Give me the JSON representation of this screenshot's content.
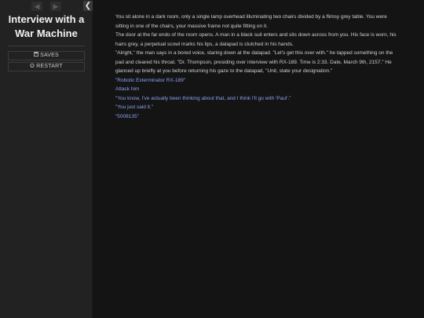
{
  "sidebar": {
    "back_arrow": "◀",
    "forward_arrow": "▶",
    "collapse_arrow": "❮",
    "title_line1": "Interview with a",
    "title_line2": "War Machine",
    "saves_label": "SAVES",
    "restart_label": "RESTART"
  },
  "passage": {
    "paragraphs": [
      "You sit alone in a dark room, only a single lamp overhead illuminating two chairs divided by a flimsy grey table. You were sitting in one of the chairs, your massive frame not quite fitting on it.",
      "The door at the far endo of the room opens. A man in a black suit enters and sits down across from you. His face is worn, his hairs grey, a perpetual scowl marks his lips, a datapad is clutched in his hands.",
      "\"Alright,\" the man says in a bored voice, staring down at the datapad. \"Let's get this over with.\" he tapped something on the pad and cleared his throat. \"Dr. Thompson, presiding over interview with RX-189. Time is 2:33. Date, March 9th, 2157.\" He glanced up briefly at you before returning his gaze to the datapad, \"Unit, state your designation.\""
    ],
    "links": [
      "\"Robotic Exterminator RX-189\"",
      "Attack him",
      "\"You know, I've actually been thinking about that, and I think I'll go with 'Paul'.\"",
      "\"You just said it.\"",
      "\"5008135\""
    ]
  }
}
